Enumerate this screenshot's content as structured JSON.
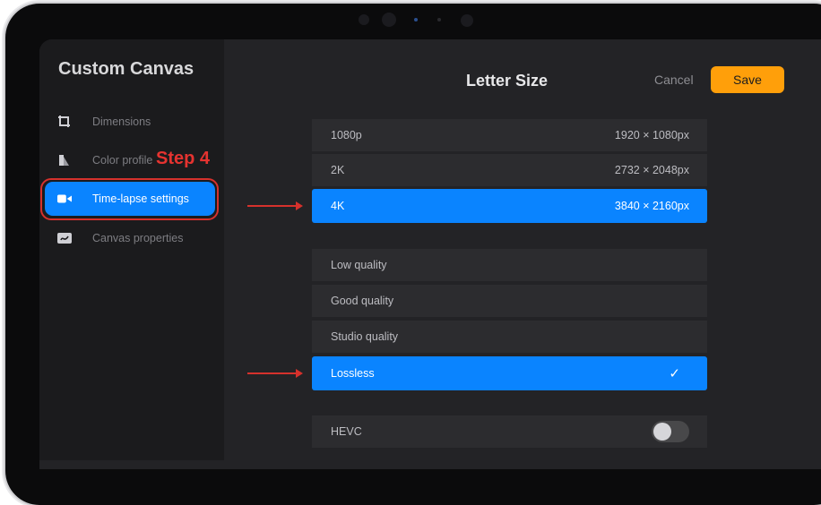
{
  "sidebar": {
    "title": "Custom Canvas",
    "items": [
      {
        "label": "Dimensions",
        "icon": "crop-corners-icon"
      },
      {
        "label": "Color profile",
        "icon": "color-swatch-icon"
      },
      {
        "label": "Time-lapse settings",
        "icon": "video-camera-icon",
        "active": true
      },
      {
        "label": "Canvas properties",
        "icon": "canvas-properties-icon"
      }
    ]
  },
  "annotation": {
    "step_label": "Step 4"
  },
  "header": {
    "title": "Letter Size",
    "cancel_label": "Cancel",
    "save_label": "Save"
  },
  "resolution_options": [
    {
      "name": "1080p",
      "size": "1920 × 1080px"
    },
    {
      "name": "2K",
      "size": "2732 × 2048px"
    },
    {
      "name": "4K",
      "size": "3840 × 2160px",
      "selected": true
    }
  ],
  "quality_options": [
    {
      "name": "Low quality"
    },
    {
      "name": "Good quality"
    },
    {
      "name": "Studio quality"
    },
    {
      "name": "Lossless",
      "selected": true
    }
  ],
  "hevc": {
    "label": "HEVC",
    "enabled": false
  },
  "colors": {
    "accent": "#0a84ff",
    "save": "#ff9f0a",
    "annotation": "#d6312c"
  }
}
